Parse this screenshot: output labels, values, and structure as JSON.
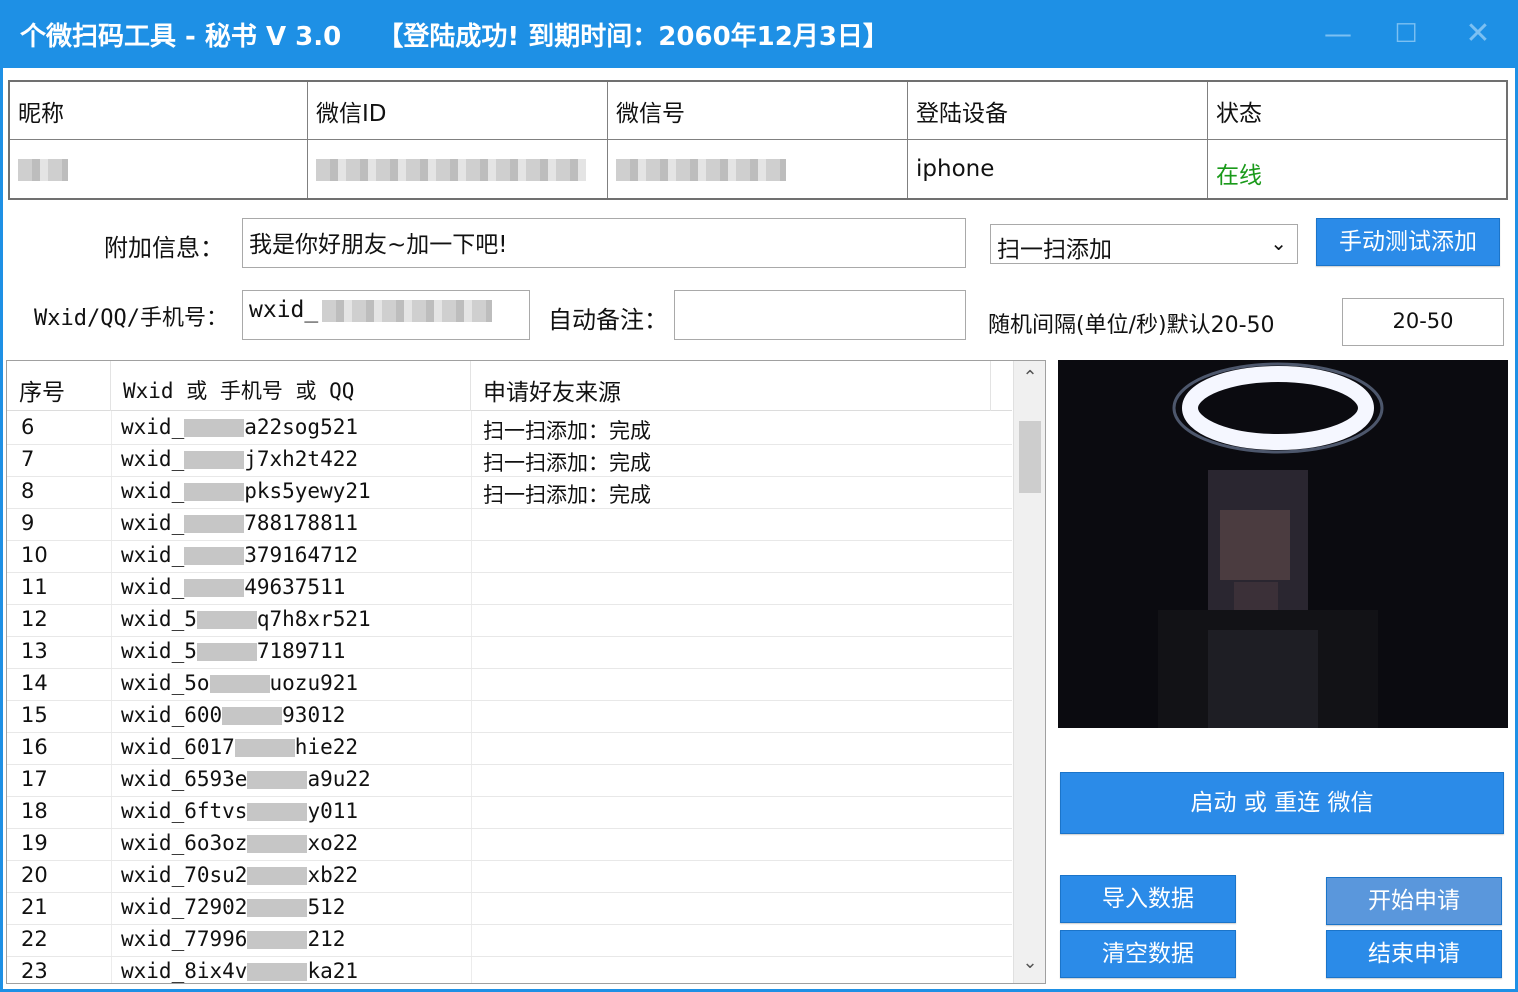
{
  "window": {
    "title": "个微扫码工具 - 秘书 V 3.0    【登陆成功! 到期时间：2060年12月3日】",
    "controls": [
      "minimize-icon",
      "maximize-icon",
      "close-icon"
    ]
  },
  "account_table": {
    "headers": [
      "昵称",
      "微信ID",
      "微信号",
      "登陆设备",
      "状态"
    ],
    "row": {
      "device": "iphone",
      "status": "在线"
    }
  },
  "form": {
    "extra_label": "附加信息：",
    "extra_value": "我是你好朋友~加一下吧!",
    "mode_select": "扫一扫添加",
    "manual_test_button": "手动测试添加",
    "wxid_label": "Wxid/QQ/手机号：",
    "wxid_value": "wxid_",
    "remark_label": "自动备注：",
    "remark_value": "",
    "interval_label": "随机间隔(单位/秒)默认20-50",
    "interval_value": "20-50"
  },
  "list": {
    "headers": [
      "序号",
      "Wxid 或 手机号 或 QQ",
      "申请好友来源"
    ],
    "rows": [
      {
        "no": "6",
        "a": "wxid_",
        "b": "a22sog521",
        "src": "扫一扫添加：完成"
      },
      {
        "no": "7",
        "a": "wxid_",
        "b": "j7xh2t422",
        "src": "扫一扫添加：完成"
      },
      {
        "no": "8",
        "a": "wxid_",
        "b": "pks5yewy21",
        "src": "扫一扫添加：完成"
      },
      {
        "no": "9",
        "a": "wxid_",
        "b": "788178811",
        "src": ""
      },
      {
        "no": "10",
        "a": "wxid_",
        "b": "379164712",
        "src": ""
      },
      {
        "no": "11",
        "a": "wxid_",
        "b": "49637511",
        "src": ""
      },
      {
        "no": "12",
        "a": "wxid_5",
        "b": "q7h8xr521",
        "src": ""
      },
      {
        "no": "13",
        "a": "wxid_5",
        "b": "7189711",
        "src": ""
      },
      {
        "no": "14",
        "a": "wxid_5o",
        "b": "uozu921",
        "src": ""
      },
      {
        "no": "15",
        "a": "wxid_600",
        "b": "93012",
        "src": ""
      },
      {
        "no": "16",
        "a": "wxid_6017",
        "b": "hie22",
        "src": ""
      },
      {
        "no": "17",
        "a": "wxid_6593e",
        "b": "a9u22",
        "src": ""
      },
      {
        "no": "18",
        "a": "wxid_6ftvs",
        "b": "y011",
        "src": ""
      },
      {
        "no": "19",
        "a": "wxid_6o3oz",
        "b": "xo22",
        "src": ""
      },
      {
        "no": "20",
        "a": "wxid_70su2",
        "b": "xb22",
        "src": ""
      },
      {
        "no": "21",
        "a": "wxid_72902",
        "b": "512",
        "src": ""
      },
      {
        "no": "22",
        "a": "wxid_77996",
        "b": "212",
        "src": ""
      },
      {
        "no": "23",
        "a": "wxid_8ix4v",
        "b": "ka21",
        "src": ""
      }
    ]
  },
  "buttons": {
    "start_wechat": "启动 或 重连 微信",
    "import": "导入数据",
    "start_apply": "开始申请",
    "clear": "清空数据",
    "end_apply": "结束申请"
  },
  "colors": {
    "titlebar": "#1e90e5",
    "button": "#2b8be8",
    "online": "#1a9a1a"
  }
}
